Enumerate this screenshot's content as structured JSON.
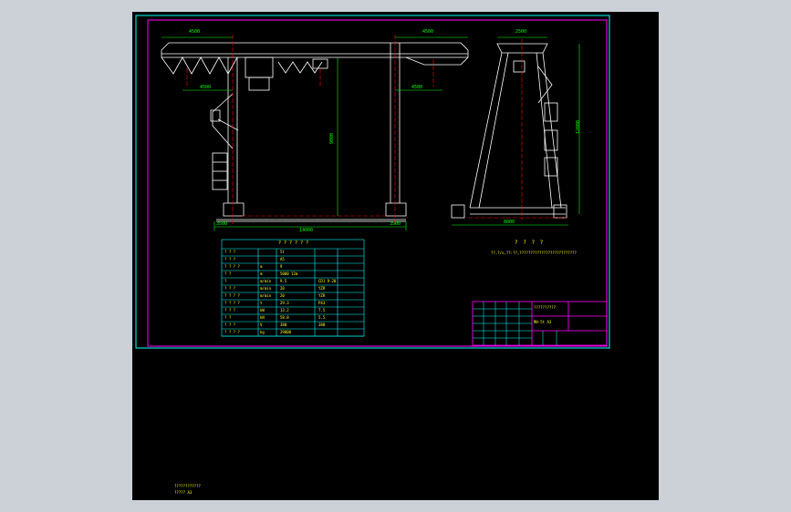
{
  "colors": {
    "sheet": "#000000",
    "frame_outer": "#00ffff",
    "frame_inner": "#ff00ff",
    "outline": "#ffffff",
    "dimension": "#00ff00",
    "centerline": "#ff0000",
    "text": "#ffff00",
    "table_grid": "#00ffff"
  },
  "front_view": {
    "dim_overall_span": "14000",
    "dim_left_cantilever": "4500",
    "dim_right_cantilever": "4500",
    "dim_hook_left": "4500",
    "dim_hook_right": "4500",
    "dim_lift_height": "9000",
    "dim_base_left": "3500",
    "dim_base_right": "3500"
  },
  "side_view": {
    "dim_top": "2500",
    "dim_height": "12000",
    "dim_base": "8000"
  },
  "spec_table": {
    "title": "? ? ? ? ? ?",
    "rows": [
      [
        "? ? ?",
        "",
        "5t",
        ""
      ],
      [
        "? ? ?",
        "",
        "A5",
        ""
      ],
      [
        "? ? ? ?",
        "m",
        "9",
        ""
      ],
      [
        "? ?",
        "m",
        "5000  12m",
        ""
      ],
      [
        "?",
        "m/min",
        "9.5",
        "CD1 9-20"
      ],
      [
        "? ? ?",
        "m/min",
        "20",
        "YZR"
      ],
      [
        "? ? ? ?",
        "m/min",
        "20",
        "YZR"
      ],
      [
        "? ? ? ?",
        "t",
        "29.3",
        "P43"
      ],
      [
        "? ? ?",
        "kW",
        "13.2",
        "7.5"
      ],
      [
        "? ?",
        "kN",
        "58.8",
        "5.5"
      ],
      [
        "? ? ?",
        "V",
        "380",
        "380"
      ],
      [
        "? ? ? ?",
        "kg",
        "29000",
        ""
      ]
    ]
  },
  "notes": {
    "title": "? ? ? ?",
    "body": "??,?/s,??:??,??????????????????????????"
  },
  "title_block": {
    "drawing_title": "??????????",
    "drawing_number": "MH-5t A3"
  },
  "bottom_caption": {
    "line1": "????????????",
    "line2": "????? A3"
  }
}
